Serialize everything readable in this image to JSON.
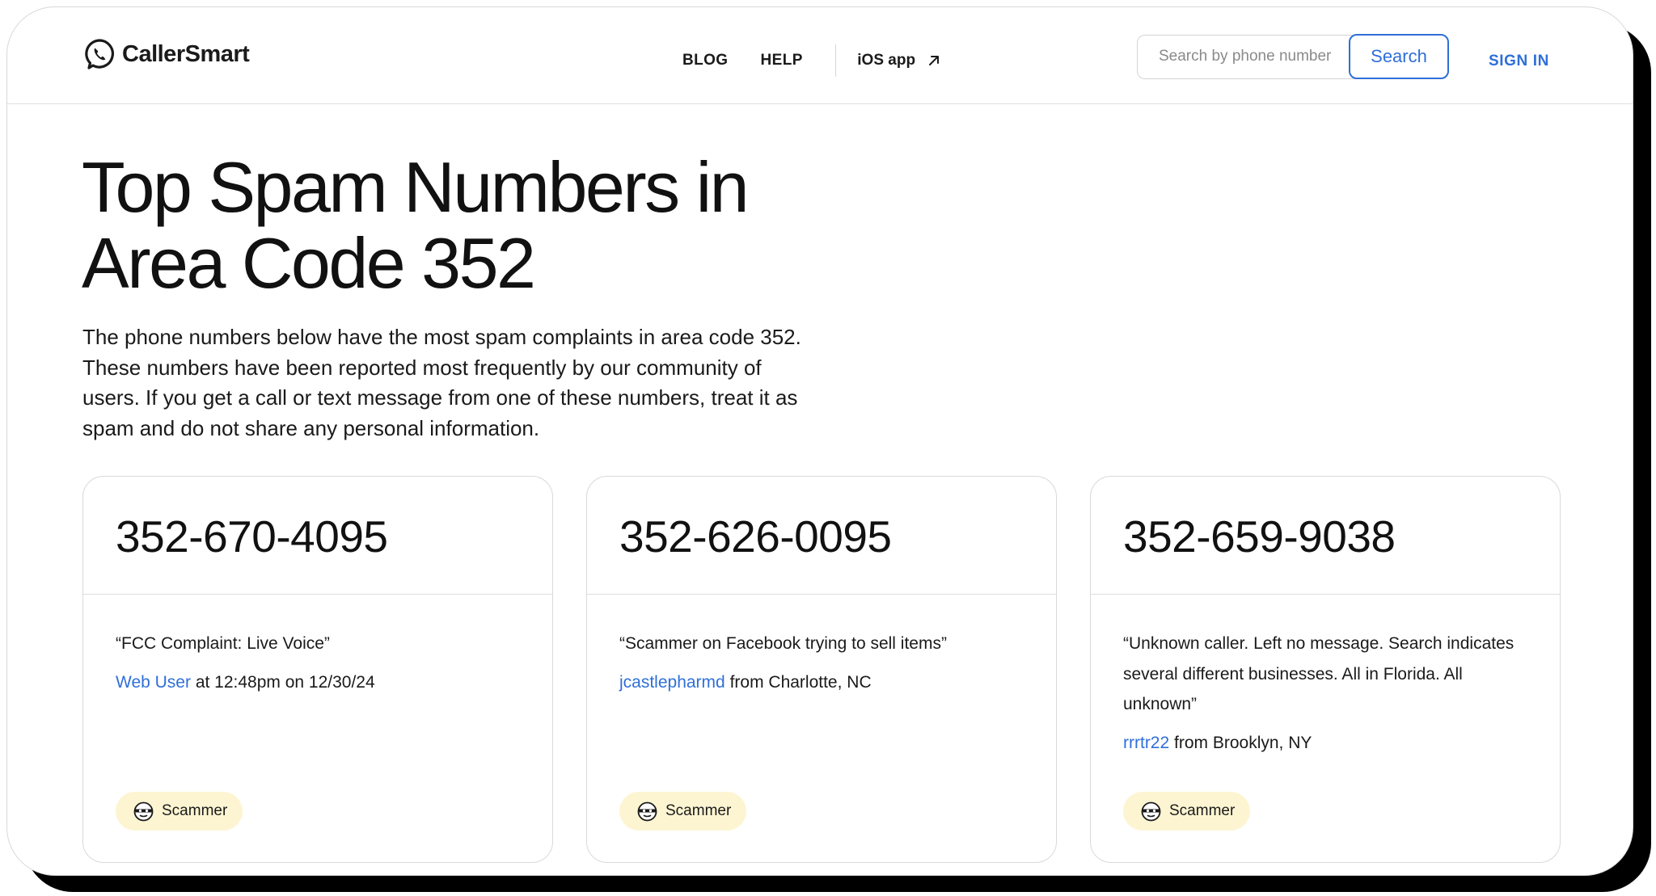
{
  "header": {
    "logo_text": "CallerSmart",
    "nav": {
      "blog": "BLOG",
      "help": "HELP",
      "ios": "iOS app"
    },
    "search": {
      "placeholder": "Search by phone number",
      "button": "Search"
    },
    "signin": "SIGN IN"
  },
  "main": {
    "title_line1": "Top Spam Numbers in",
    "title_line2": "Area Code 352",
    "intro_line1": "The phone numbers below have the most spam complaints in area code 352.",
    "intro_line2": "These numbers have been reported most frequently by our community of",
    "intro_line3": "users. If you get a call or text message from one of these numbers, treat it as",
    "intro_line4": "spam and do not share any personal information."
  },
  "cards": [
    {
      "number": "352-670-4095",
      "quote": "“FCC Complaint: Live Voice”",
      "user": "Web User",
      "detail": " at 12:48pm on 12/30/24",
      "badge": "Scammer"
    },
    {
      "number": "352-626-0095",
      "quote": "“Scammer on Facebook trying to sell items”",
      "user": "jcastlepharmd",
      "detail": " from Charlotte, NC",
      "badge": "Scammer"
    },
    {
      "number": "352-659-9038",
      "quote_line1": "“Unknown caller. Left no message. Search indicates",
      "quote_line2": "several different businesses. All in Florida. All",
      "quote_line3": "unknown”",
      "user": "rrrtr22",
      "detail": " from Brooklyn, NY",
      "badge": "Scammer"
    }
  ],
  "colors": {
    "accent": "#2f6fd8",
    "badge_bg": "#fdf5d2",
    "text": "#1a1a1a"
  }
}
